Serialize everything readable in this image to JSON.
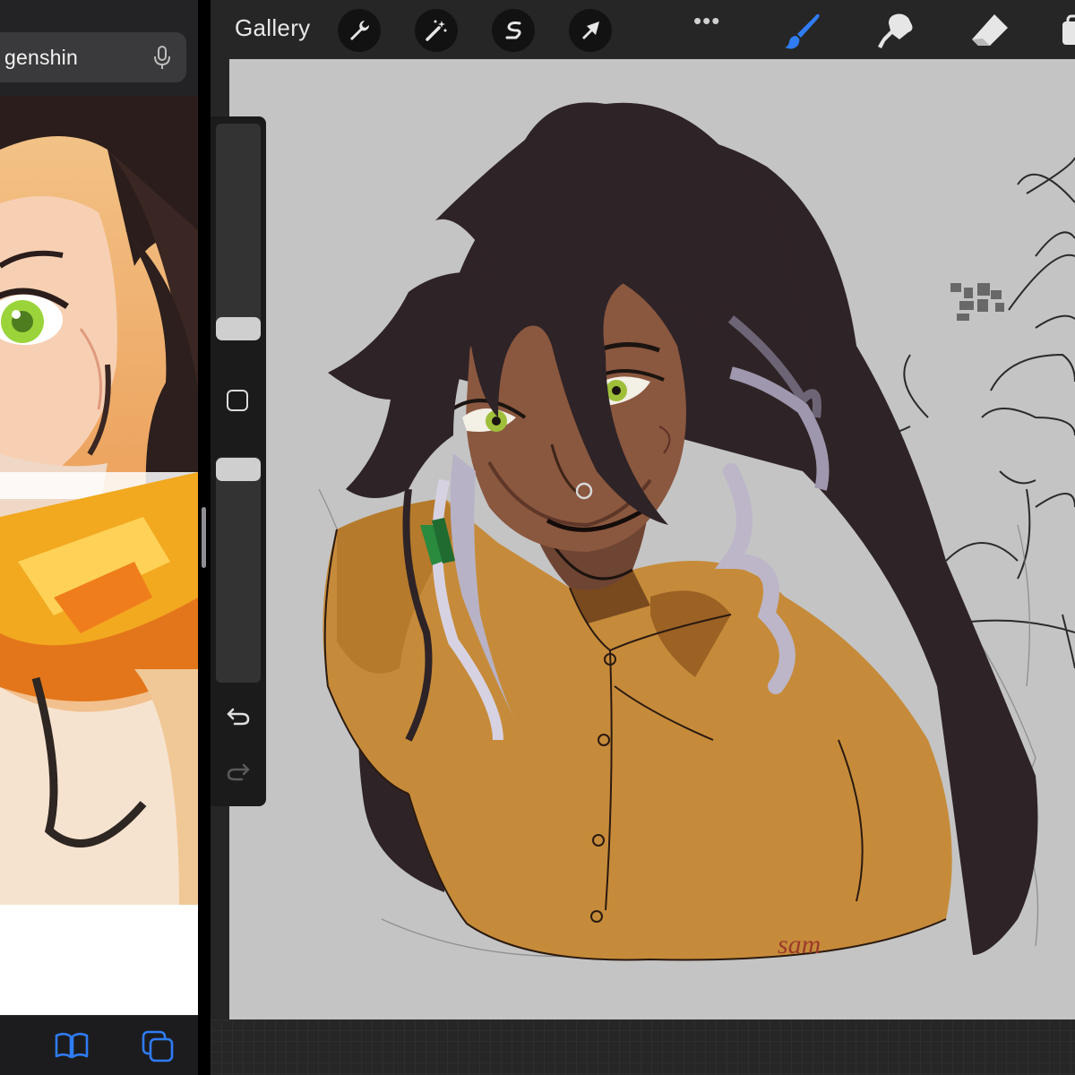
{
  "browser": {
    "search_text": "genshin",
    "icons": [
      "microphone-icon",
      "bookmarks-icon",
      "tabs-icon"
    ]
  },
  "toolbar": {
    "gallery_label": "Gallery",
    "left_tools": [
      "wrench-icon",
      "magic-wand-icon",
      "selection-icon",
      "transform-arrow-icon"
    ],
    "more_label": "•••",
    "right_tools": [
      "brush-icon",
      "smudge-icon",
      "eraser-icon",
      "layers-icon"
    ],
    "active_tool": "brush-icon",
    "active_color": "#2f7cf6"
  },
  "sidebar": {
    "size_slider_value": 0.78,
    "opacity_slider_value": 0.02,
    "buttons": [
      "modify-button",
      "undo-icon",
      "redo-icon"
    ]
  },
  "canvas": {
    "signature": "sam",
    "background_color": "#c4c4c4"
  }
}
